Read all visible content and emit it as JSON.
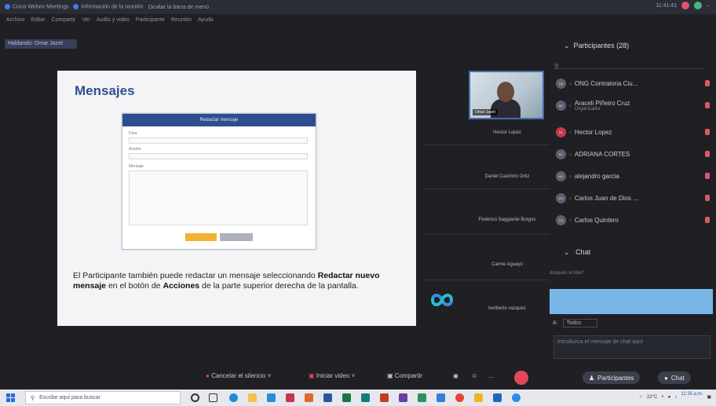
{
  "window": {
    "app_title": "Cisco Webex Meetings",
    "tab_info": "Información de la reunión",
    "hide_menu": "Ocultar la barra de menú",
    "time": "11:41:41"
  },
  "menu": [
    "Archivo",
    "Editar",
    "Compartir",
    "Ver",
    "Audio y video",
    "Participante",
    "Reunión",
    "Ayuda"
  ],
  "speaking": "Hablando: Omar Jazet",
  "slide": {
    "title": "Mensajes",
    "dialog_title": "Redactar mensaje",
    "field_labels": [
      "Para",
      "Asunto",
      "Mensaje"
    ],
    "text_pre": "El Participante también puede redactar un mensaje seleccionando ",
    "text_bold_1": "Redactar nuevo mensaje",
    "text_mid": " en el botón de ",
    "text_bold_2": "Acciones",
    "text_post": " de la parte superior derecha de la pantalla."
  },
  "videos": {
    "self_name": "Omar Jazet",
    "names": [
      "Hector Lopez",
      "Daniel Casimiro Ortiz",
      "Federico Saggiante Burgos",
      "Carme Aguayo",
      "heriberto vazquez"
    ]
  },
  "participants": {
    "header": "Participantes (28)",
    "items": [
      {
        "initials": "OA",
        "name": "ONG Contraloria Ciu...",
        "sub": "",
        "red": false
      },
      {
        "initials": "AC",
        "name": "Araceli Piñeiro Cruz",
        "sub": "Organizador",
        "red": false
      },
      {
        "initials": "HL",
        "name": "Hector Lopez",
        "sub": "",
        "red": true
      },
      {
        "initials": "AC",
        "name": "ADRIANA CORTES",
        "sub": "",
        "red": false
      },
      {
        "initials": "AG",
        "name": "alejandro garcia",
        "sub": "",
        "red": false
      },
      {
        "initials": "CD",
        "name": "Carlos Juan de Dios ...",
        "sub": "",
        "red": false
      },
      {
        "initials": "CQ",
        "name": "Carlos Quintero",
        "sub": "",
        "red": false
      }
    ]
  },
  "chat": {
    "header": "Chat",
    "prev_line_2": "después el lote?",
    "to_label": "A:",
    "to_value": "Todos",
    "input_placeholder": "Introduzca el mensaje de chat aquí"
  },
  "controls": {
    "mute": "Cancelar el silencio",
    "video": "Iniciar video",
    "share": "Compartir",
    "participants_btn": "Participantes",
    "chat_btn": "Chat"
  },
  "taskbar": {
    "search_placeholder": "Escribe aquí para buscar",
    "temp": "22°C",
    "time": "11:35 a.m."
  },
  "colors": {
    "accent": "#2e4d8e",
    "end_call": "#e2485a",
    "chat_highlight": "#78b6e8"
  }
}
